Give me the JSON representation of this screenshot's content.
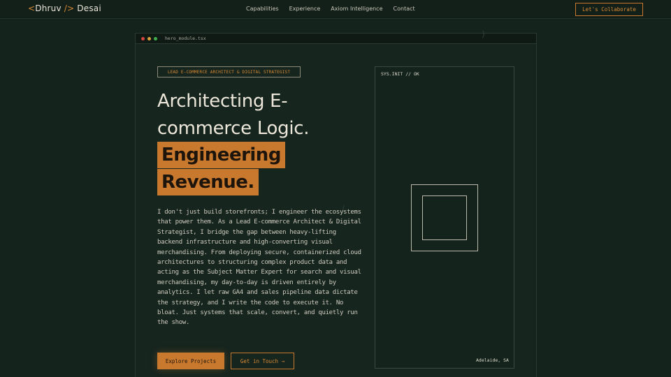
{
  "nav": {
    "logo": {
      "open": "<",
      "first": "Dhruv",
      "slash": "/>",
      "last": "Desai"
    },
    "links": [
      "Capabilities",
      "Experience",
      "Axiom Intelligence",
      "Contact"
    ],
    "cta": "Let's Collaborate"
  },
  "window": {
    "filename": "hero_module.tsx"
  },
  "hero": {
    "badge": "LEAD E-COMMERCE ARCHITECT & DIGITAL STRATEGIST",
    "headline_line1": "Architecting E-",
    "headline_line2": "commerce Logic.",
    "highlight_line1": "Engineering",
    "highlight_line2": "Revenue.",
    "paragraph": "I don't just build storefronts; I engineer the ecosystems that power them. As a Lead E-commerce Architect & Digital Strategist, I bridge the gap between heavy-lifting backend infrastructure and high-converting visual merchandising. From deploying secure, containerized cloud architectures to structuring complex product data and acting as the Subject Matter Expert for search and visual merchandising, my day-to-day is driven entirely by analytics. I let raw GA4 and sales pipeline data dictate the strategy, and I write the code to execute it. No bloat. Just systems that scale, convert, and quietly run the show.",
    "primary_button": "Explore Projects",
    "secondary_button": "Get in Touch →"
  },
  "panel": {
    "status": "SYS.INIT // OK",
    "location": "Adelaide, SA"
  },
  "colors": {
    "background": "#15231d",
    "accent": "#c9792d",
    "text": "#ece7da"
  }
}
